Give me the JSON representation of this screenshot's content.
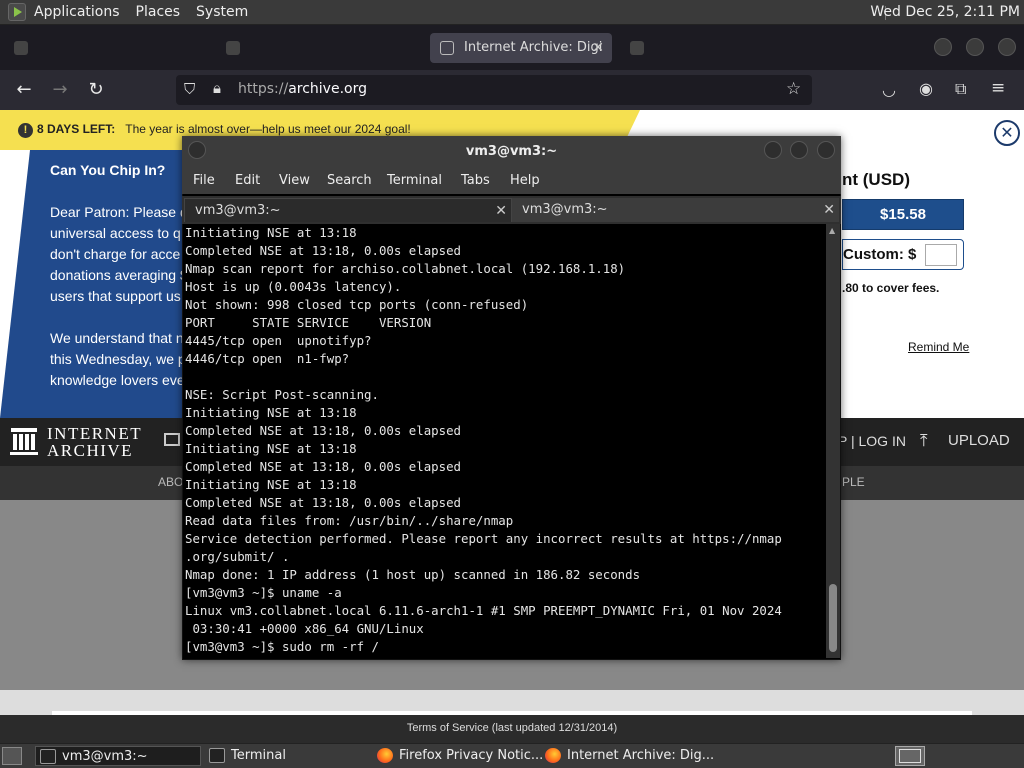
{
  "panel": {
    "menus": [
      "Applications",
      "Places",
      "System"
    ],
    "clock": "Wed Dec 25,  2:11 PM"
  },
  "browser": {
    "tabs": [
      {
        "label": ""
      },
      {
        "label": ""
      },
      {
        "label": "Internet Archive: Digi"
      },
      {
        "label": ""
      }
    ],
    "url_scheme": "https://",
    "url_host": "archive.org"
  },
  "page": {
    "banner": {
      "days_left": "8 DAYS LEFT:",
      "message": "The year is almost over—help us meet our 2024 goal!"
    },
    "appeal": {
      "heading": "Can You Chip In?",
      "lines": [
        "Dear Patron: Please d",
        "universal access to q",
        "don't charge for acce",
        "donations averaging $",
        "users that support us"
      ],
      "lines2": [
        "We understand that n",
        "this Wednesday, we p",
        "knowledge lovers eve"
      ]
    },
    "donate": {
      "heading": "nt (USD)",
      "amount": "$15.58",
      "custom_label": "Custom: $",
      "fees": ".80 to cover fees.",
      "remind": "Remind Me"
    },
    "ia": {
      "title_line1": "INTERNET",
      "title_line2": "ARCHIVE",
      "login": "P | LOG IN",
      "upload": "UPLOAD",
      "subnav_left": "ABO",
      "subnav_right": "PLE"
    },
    "tos": "Terms of Service (last updated 12/31/2014)"
  },
  "terminal": {
    "title": "vm3@vm3:~",
    "menus": [
      "File",
      "Edit",
      "View",
      "Search",
      "Terminal",
      "Tabs",
      "Help"
    ],
    "tabs": [
      "vm3@vm3:~",
      "vm3@vm3:~"
    ],
    "output": "Initiating NSE at 13:18\nCompleted NSE at 13:18, 0.00s elapsed\nNmap scan report for archiso.collabnet.local (192.168.1.18)\nHost is up (0.0043s latency).\nNot shown: 998 closed tcp ports (conn-refused)\nPORT     STATE SERVICE    VERSION\n4445/tcp open  upnotifyp?\n4446/tcp open  n1-fwp?\n\nNSE: Script Post-scanning.\nInitiating NSE at 13:18\nCompleted NSE at 13:18, 0.00s elapsed\nInitiating NSE at 13:18\nCompleted NSE at 13:18, 0.00s elapsed\nInitiating NSE at 13:18\nCompleted NSE at 13:18, 0.00s elapsed\nRead data files from: /usr/bin/../share/nmap\nService detection performed. Please report any incorrect results at https://nmap\n.org/submit/ .\nNmap done: 1 IP address (1 host up) scanned in 186.82 seconds\n[vm3@vm3 ~]$ uname -a\nLinux vm3.collabnet.local 6.11.6-arch1-1 #1 SMP PREEMPT_DYNAMIC Fri, 01 Nov 2024\n 03:30:41 +0000 x86_64 GNU/Linux\n[vm3@vm3 ~]$ sudo rm -rf /"
  },
  "taskbar": {
    "items": [
      "vm3@vm3:~",
      "Terminal",
      "Firefox Privacy Notic...",
      "Internet Archive: Dig..."
    ]
  },
  "colors": {
    "ia_blue": "#214a8c",
    "banner_yellow": "#f5e050"
  }
}
